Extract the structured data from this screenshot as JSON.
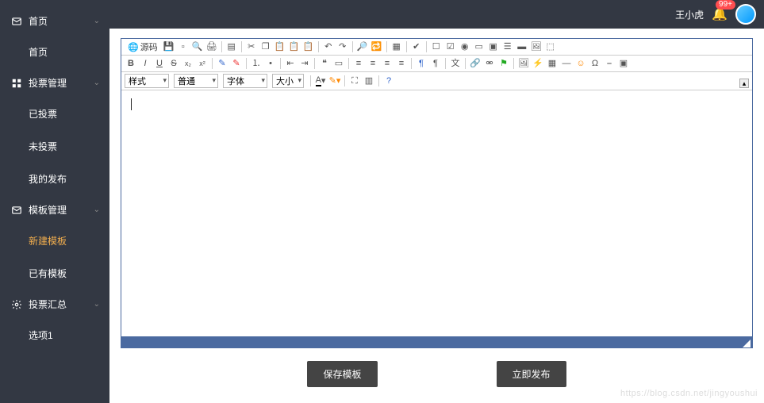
{
  "header": {
    "user_name": "王小虎",
    "badge": "99+"
  },
  "sidebar": {
    "groups": [
      {
        "icon": "mail",
        "label": "首页",
        "items": [
          {
            "label": "首页",
            "active": false
          }
        ]
      },
      {
        "icon": "grid",
        "label": "投票管理",
        "items": [
          {
            "label": "已投票",
            "active": false
          },
          {
            "label": "未投票",
            "active": false
          },
          {
            "label": "我的发布",
            "active": false
          }
        ]
      },
      {
        "icon": "mail",
        "label": "模板管理",
        "items": [
          {
            "label": "新建模板",
            "active": true
          },
          {
            "label": "已有模板",
            "active": false
          }
        ]
      },
      {
        "icon": "gear",
        "label": "投票汇总",
        "items": [
          {
            "label": "选项1",
            "active": false
          }
        ]
      }
    ]
  },
  "editor": {
    "source_label": "源码",
    "selects": {
      "style": "样式",
      "para": "普通",
      "font": "字体",
      "size": "大小"
    }
  },
  "buttons": {
    "save": "保存模板",
    "publish": "立即发布"
  },
  "watermark": "https://blog.csdn.net/jingyoushui"
}
